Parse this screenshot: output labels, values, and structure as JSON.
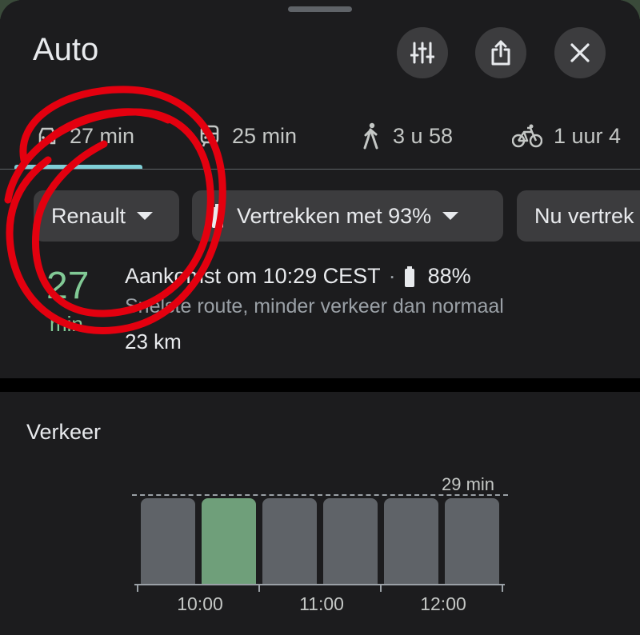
{
  "header": {
    "title": "Auto"
  },
  "buttons": {
    "options": "route-options-icon",
    "share": "share-icon",
    "close": "close-icon"
  },
  "tabs": [
    {
      "mode": "car",
      "label": "27 min"
    },
    {
      "mode": "transit",
      "label": "25 min"
    },
    {
      "mode": "walk",
      "label": "3 u 58"
    },
    {
      "mode": "bike",
      "label": "1 uur 4"
    }
  ],
  "chips": {
    "vehicle": "Renault",
    "departure_charge": "Vertrekken met 93%",
    "depart_time": "Nu vertrek"
  },
  "route": {
    "duration_value": "27",
    "duration_unit": "min",
    "arrival": "Aankomst om 10:29 CEST",
    "separator": "·",
    "battery": "88%",
    "description": "Snelste route, minder verkeer dan normaal",
    "distance": "23 km"
  },
  "traffic": {
    "title": "Verkeer",
    "reference_label": "29 min",
    "time_labels": [
      "10:00",
      "11:00",
      "12:00"
    ],
    "active_index": 1
  },
  "colors": {
    "accent": "#81c995",
    "tab_underline": "#7fcfd7",
    "annotation": "#e3000f"
  }
}
